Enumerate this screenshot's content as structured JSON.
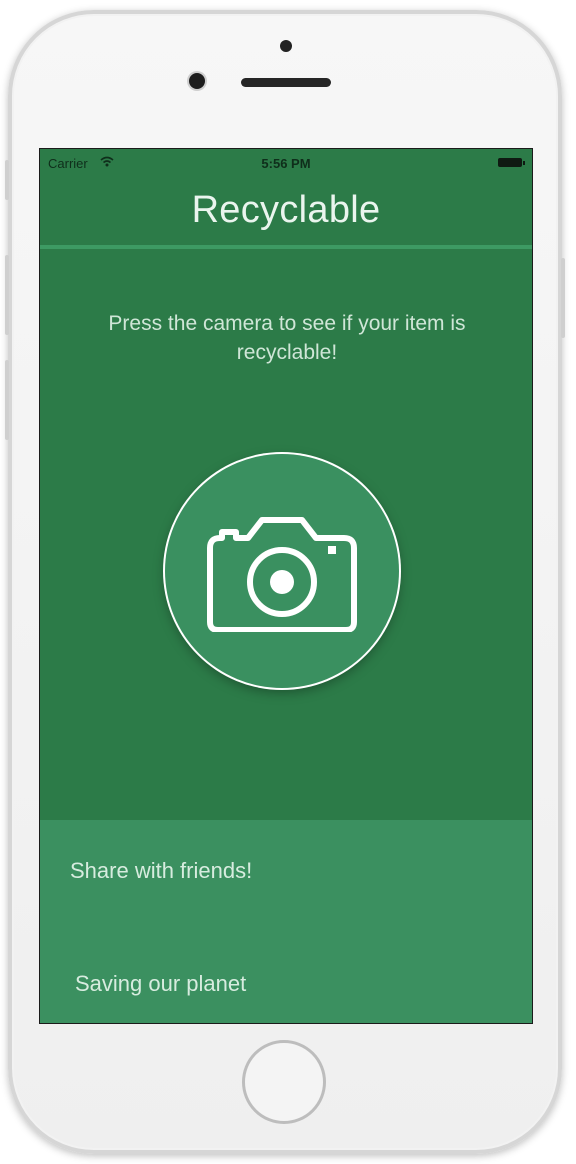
{
  "status_bar": {
    "carrier": "Carrier",
    "time": "5:56 PM",
    "wifi_icon": "wifi-icon",
    "battery_icon": "battery-icon"
  },
  "nav": {
    "title": "Recyclable"
  },
  "main": {
    "instructions": "Press the camera to see if your item is recyclable!",
    "camera_icon": "camera-icon"
  },
  "bottom": {
    "share_label": "Share with friends!",
    "tagline": "Saving our planet"
  },
  "colors": {
    "background": "#2c7b48",
    "panel": "#3b9060",
    "accent_line": "#3d9a63",
    "text": "#eaf5ee"
  }
}
